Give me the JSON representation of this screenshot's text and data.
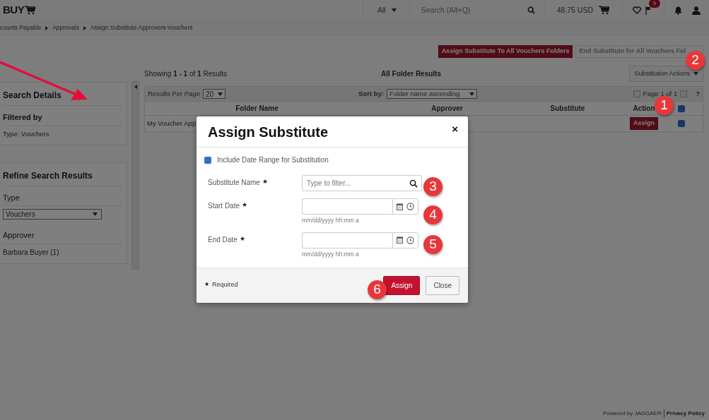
{
  "header": {
    "logo": "BUY",
    "scope": "All",
    "search_placeholder": "Search (Alt+Q)",
    "cart_total": "48.75 USD",
    "notification_count": "9"
  },
  "breadcrumb": [
    "counts Payable",
    "Approvals",
    "Assign Substitute Approvers-Vouchers"
  ],
  "sidebar": {
    "search_details": {
      "title": "Search Details",
      "filter_heading": "Filtered by",
      "filters": [
        "Type: Vouchers"
      ]
    },
    "refine": {
      "title": "Refine Search Results",
      "groups": [
        {
          "kind": "select",
          "label": "Type",
          "value": "Vouchers"
        },
        {
          "kind": "list",
          "label": "Approver",
          "items": [
            "Barbara Buyer (1)"
          ]
        }
      ]
    }
  },
  "actions": [
    {
      "label": "Assign Substitute To All Vouchers Folders",
      "disabled": false
    },
    {
      "label": "End Substitute for All Vouchers Fol",
      "disabled": true
    }
  ],
  "results": {
    "showing": "Showing **1 - 1** of **1** Results",
    "title": "All Folder Results",
    "menu_button": "Substitution Actions",
    "per_page_label": "Results Per Page",
    "per_page": "20",
    "sort_label": "Sort by:",
    "sort_value": "Folder name ascending",
    "pagination": "Page 1 of 1",
    "help": "?"
  },
  "table": {
    "columns": [
      "Folder Name",
      "Approver",
      "Substitute",
      "Action"
    ],
    "header_checked": true,
    "rows": [
      {
        "folder_name": "My Voucher App",
        "action": "Assign",
        "checked": true
      }
    ]
  },
  "modal": {
    "title": "Assign Substitute",
    "close": "×",
    "required_mark": "★",
    "date_range": {
      "label": "Include Date Range for Substitution",
      "checked": true
    },
    "fields": [
      {
        "kind": "search",
        "label": "Substitute Name",
        "required": true,
        "placeholder": "Type to filter..."
      },
      {
        "kind": "datetime",
        "label": "Start Date",
        "required": true,
        "hint": "mm/dd/yyyy hh:mm a"
      },
      {
        "kind": "datetime",
        "label": "End Date",
        "required": true,
        "hint": "mm/dd/yyyy hh:mm a"
      }
    ],
    "required_note": "Required",
    "buttons": [
      {
        "label": "Assign",
        "kind": "primary"
      },
      {
        "label": "Close",
        "kind": "secondary"
      }
    ]
  },
  "annotations": [
    {
      "label": "1"
    },
    {
      "label": "2"
    },
    {
      "label": "3"
    },
    {
      "label": "4"
    },
    {
      "label": "5"
    },
    {
      "label": "6"
    }
  ],
  "footer": {
    "powered_by": "Powered by JAGGAER",
    "link": "Privacy Policy"
  }
}
